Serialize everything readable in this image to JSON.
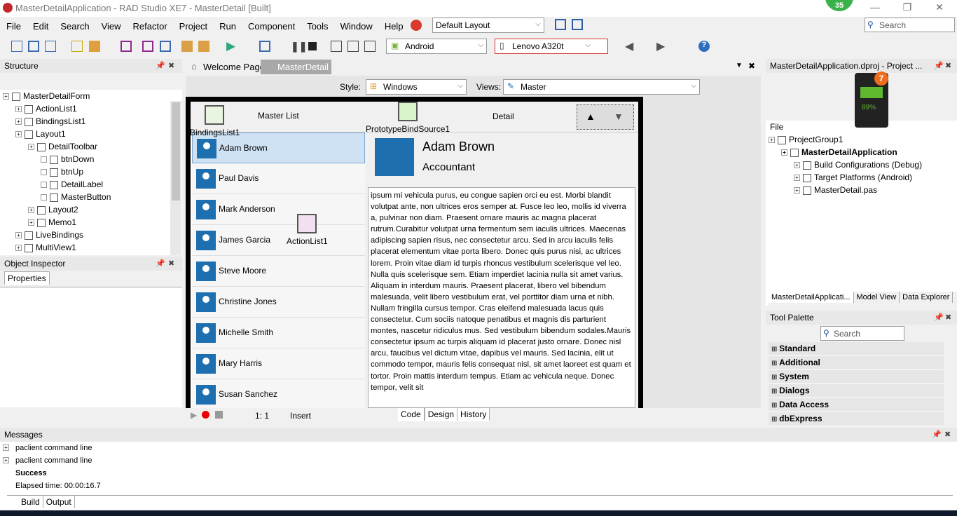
{
  "window": {
    "title": "MasterDetailApplication - RAD Studio XE7 - MasterDetail [Built]",
    "notification_count": "35"
  },
  "menu": [
    "File",
    "Edit",
    "Search",
    "View",
    "Refactor",
    "Project",
    "Run",
    "Component",
    "Tools",
    "Window",
    "Help"
  ],
  "layout_combo": "Default Layout",
  "search_placeholder": "Search",
  "platform_combo": "Android",
  "device_combo": "Lenovo A320t",
  "structure": {
    "title": "Structure",
    "items": [
      {
        "label": "MasterDetailForm",
        "level": 0
      },
      {
        "label": "ActionList1",
        "level": 1
      },
      {
        "label": "BindingsList1",
        "level": 1
      },
      {
        "label": "Layout1",
        "level": 1
      },
      {
        "label": "DetailToolbar",
        "level": 2
      },
      {
        "label": "btnDown",
        "level": 3
      },
      {
        "label": "btnUp",
        "level": 3
      },
      {
        "label": "DetailLabel",
        "level": 3
      },
      {
        "label": "MasterButton",
        "level": 3
      },
      {
        "label": "Layout2",
        "level": 2
      },
      {
        "label": "Memo1",
        "level": 2
      },
      {
        "label": "LiveBindings",
        "level": 1
      },
      {
        "label": "MultiView1",
        "level": 1
      }
    ]
  },
  "object_inspector": {
    "title": "Object Inspector",
    "tab": "Properties"
  },
  "editor_tabs": [
    "Welcome Page",
    "MasterDetail"
  ],
  "style_label": "Style:",
  "style_value": "Windows",
  "views_label": "Views:",
  "views_value": "Master",
  "form": {
    "master_title": "Master List",
    "detail_title": "Detail",
    "components": [
      "BindingsList1",
      "PrototypeBindSource1",
      "ActionList1"
    ],
    "people": [
      "Adam Brown",
      "Paul Davis",
      "Mark Anderson",
      "James Garcia",
      "Steve Moore",
      "Christine Jones",
      "Michelle Smith",
      "Mary Harris",
      "Susan Sanchez"
    ],
    "detail_name": "Adam Brown",
    "detail_role": "Accountant",
    "memo": "ipsum mi vehicula purus, eu congue sapien orci eu est. Morbi blandit volutpat ante, non ultrices eros semper at. Fusce leo leo, mollis id viverra a, pulvinar non diam. Praesent ornare mauris ac magna placerat rutrum.Curabitur volutpat urna fermentum sem iaculis ultrices. Maecenas adipiscing sapien risus, nec consectetur arcu. Sed in arcu iaculis felis placerat elementum vitae porta libero. Donec quis purus nisi, ac ultrices lorem. Proin vitae diam id turpis rhoncus vestibulum scelerisque vel leo. Nulla quis scelerisque sem. Etiam imperdiet lacinia nulla sit amet varius. Aliquam in interdum mauris. Praesent placerat, libero vel bibendum malesuada, velit libero vestibulum erat, vel porttitor diam urna et nibh. Nullam fringilla cursus tempor. Cras eleifend malesuada lacus quis consectetur. Cum sociis natoque penatibus et magnis dis parturient montes, nascetur ridiculus mus. Sed vestibulum bibendum sodales.Mauris consectetur ipsum ac turpis aliquam id placerat justo ornare. Donec nisl arcu, faucibus vel dictum vitae, dapibus vel mauris. Sed lacinia, elit ut commodo tempor, mauris felis consequat nisl, sit amet laoreet est quam et tortor. Proin mattis interdum tempus. Etiam ac vehicula neque. Donec tempor, velit sit"
  },
  "status": {
    "position": "1:  1",
    "mode": "Insert",
    "tabs": [
      "Code",
      "Design",
      "History"
    ]
  },
  "project": {
    "title": "MasterDetailApplication.dproj - Project ...",
    "file_label": "File",
    "items": [
      {
        "label": "ProjectGroup1",
        "level": 0,
        "bold": false
      },
      {
        "label": "MasterDetailApplication",
        "level": 1,
        "bold": true
      },
      {
        "label": "Build Configurations (Debug)",
        "level": 2,
        "bold": false
      },
      {
        "label": "Target Platforms (Android)",
        "level": 2,
        "bold": false
      },
      {
        "label": "MasterDetail.pas",
        "level": 2,
        "bold": false
      }
    ],
    "tabs": [
      "MasterDetailApplicati...",
      "Model View",
      "Data Explorer"
    ]
  },
  "battery": {
    "percent": "89%",
    "badge": "7"
  },
  "tool_palette": {
    "title": "Tool Palette",
    "search_placeholder": "Search",
    "categories": [
      "Standard",
      "Additional",
      "System",
      "Dialogs",
      "Data Access",
      "dbExpress"
    ]
  },
  "messages": {
    "title": "Messages",
    "lines": [
      "paclient command line",
      "paclient command line",
      "Success",
      "Elapsed time: 00:00:16.7"
    ],
    "tabs": [
      "Build",
      "Output"
    ]
  }
}
